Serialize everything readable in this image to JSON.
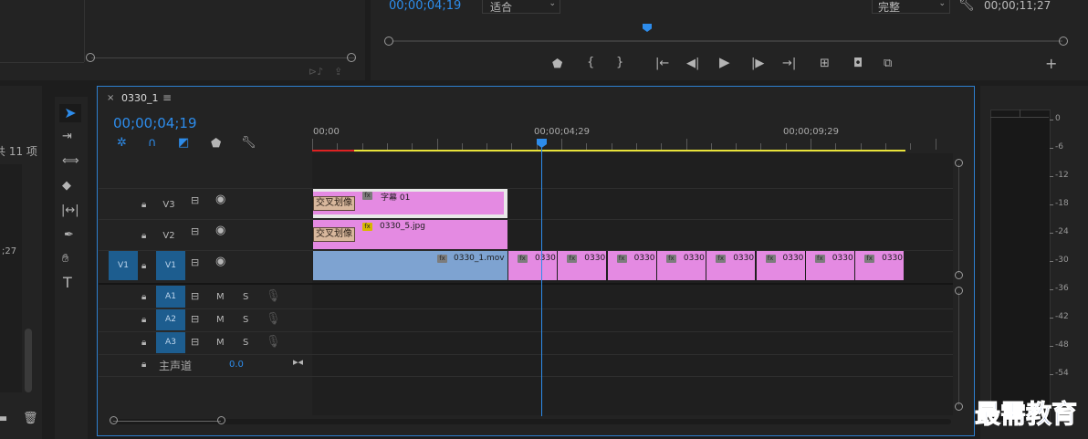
{
  "program_monitor": {
    "timecode": "00;00;04;19",
    "fit_select": "适合",
    "quality_select": "完整",
    "duration": "00;00;11;27"
  },
  "project_panel": {
    "items_count": "共 11 项",
    "side_time": ";27"
  },
  "sequence": {
    "tab_name": "0330_1",
    "close_symbol": "×",
    "menu_symbol": "≡",
    "timecode": "00;00;04;19",
    "ruler": [
      "00;00",
      "00;00;04;29",
      "00;00;09;29"
    ]
  },
  "tracks": {
    "video": [
      {
        "name": "V3",
        "source": ""
      },
      {
        "name": "V2",
        "source": ""
      },
      {
        "name": "V1",
        "source": "V1"
      }
    ],
    "audio": [
      {
        "name": "A1",
        "m": "M",
        "s": "S"
      },
      {
        "name": "A2",
        "m": "M",
        "s": "S"
      },
      {
        "name": "A3",
        "m": "M",
        "s": "S"
      }
    ],
    "master": {
      "label": "主声道",
      "value": "0.0"
    }
  },
  "clips": {
    "v3_title": "字幕 01",
    "v3_transition": "交叉划像",
    "v2_image": "0330_5.jpg",
    "v2_transition": "交叉划像",
    "v1_main": "0330_1.mov",
    "v1_repeat": [
      "0330",
      "0330",
      "0330",
      "0330",
      "0330",
      "0330",
      "0330",
      "0330"
    ],
    "fx": "fx"
  },
  "meter_scale": [
    "0",
    "-6",
    "-12",
    "-18",
    "-24",
    "-30",
    "-36",
    "-42",
    "-48",
    "-54"
  ],
  "watermark": "最需教育",
  "colors": {
    "accent_blue": "#2d8ceb",
    "clip_pink": "#e48ae2",
    "clip_blue": "#7ea3d1",
    "workarea_yellow": "#e8e23a"
  }
}
